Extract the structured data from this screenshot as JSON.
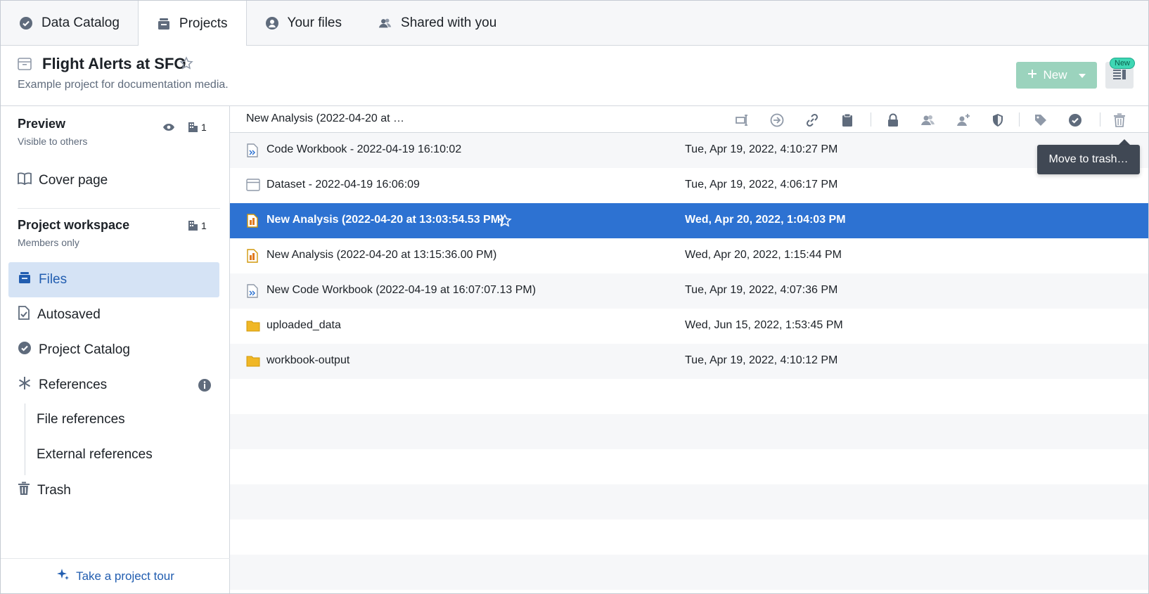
{
  "tabs": [
    {
      "label": "Data Catalog",
      "icon": "badge-check-icon"
    },
    {
      "label": "Projects",
      "icon": "projects-icon"
    },
    {
      "label": "Your files",
      "icon": "person-icon"
    },
    {
      "label": "Shared with you",
      "icon": "people-icon"
    }
  ],
  "header": {
    "title": "Flight Alerts at SFO",
    "description": "Example project for documentation media.",
    "new_button": "New",
    "new_badge": "New"
  },
  "sidebar": {
    "preview": {
      "title": "Preview",
      "subtitle": "Visible to others",
      "count": "1"
    },
    "cover_page": "Cover page",
    "workspace": {
      "title": "Project workspace",
      "subtitle": "Members only",
      "count": "1"
    },
    "items": [
      {
        "label": "Files"
      },
      {
        "label": "Autosaved"
      },
      {
        "label": "Project Catalog"
      },
      {
        "label": "References"
      }
    ],
    "sub_items": [
      "File references",
      "External references"
    ],
    "trash": "Trash",
    "tour": "Take a project tour"
  },
  "toolbar": {
    "breadcrumb": "New Analysis (2022-04-20 at …",
    "tooltip": "Move to trash…"
  },
  "files": [
    {
      "name": "Code Workbook - 2022-04-19 16:10:02",
      "date": "Tue, Apr 19, 2022, 4:10:27 PM",
      "type": "code-workbook"
    },
    {
      "name": "Dataset - 2022-04-19 16:06:09",
      "date": "Tue, Apr 19, 2022, 4:06:17 PM",
      "type": "dataset"
    },
    {
      "name": "New Analysis (2022-04-20 at 13:03:54.53 PM)",
      "date": "Wed, Apr 20, 2022, 1:04:03 PM",
      "type": "analysis",
      "selected": true
    },
    {
      "name": "New Analysis (2022-04-20 at 13:15:36.00 PM)",
      "date": "Wed, Apr 20, 2022, 1:15:44 PM",
      "type": "analysis"
    },
    {
      "name": "New Code Workbook (2022-04-19 at 16:07:07.13 PM)",
      "date": "Tue, Apr 19, 2022, 4:07:36 PM",
      "type": "code-workbook"
    },
    {
      "name": "uploaded_data",
      "date": "Wed, Jun 15, 2022, 1:53:45 PM",
      "type": "folder"
    },
    {
      "name": "workbook-output",
      "date": "Tue, Apr 19, 2022, 4:10:12 PM",
      "type": "folder"
    }
  ],
  "colors": {
    "accent": "#2d72d2",
    "selected_nav": "#d5e3f5",
    "new_button": "#9bd3bd"
  }
}
